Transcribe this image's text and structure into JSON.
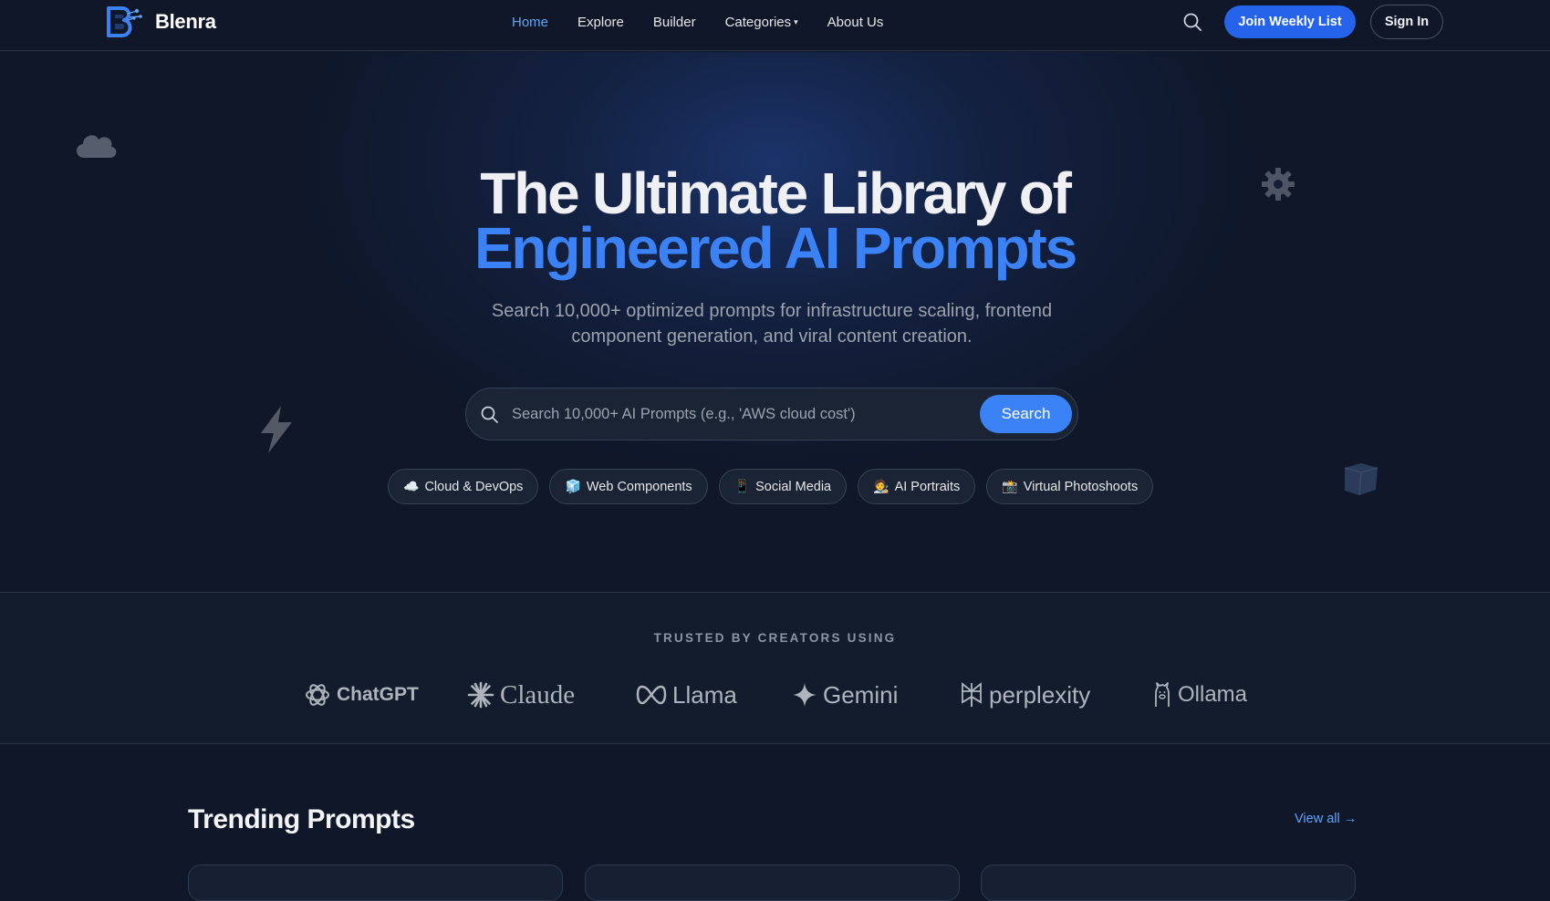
{
  "brand": {
    "name": "Blenra"
  },
  "nav": {
    "links": [
      {
        "label": "Home",
        "active": true
      },
      {
        "label": "Explore"
      },
      {
        "label": "Builder"
      },
      {
        "label": "Categories",
        "caret": "▾"
      },
      {
        "label": "About Us"
      }
    ],
    "search_icon": "search-icon",
    "join_label": "Join Weekly List",
    "signin_label": "Sign In"
  },
  "hero": {
    "title_line1": "The Ultimate Library of",
    "title_line2": "Engineered AI Prompts",
    "subtitle": "Search 10,000+ optimized prompts for infrastructure scaling, frontend component generation, and viral content creation.",
    "search": {
      "placeholder": "Search 10,000+ AI Prompts (e.g., 'AWS cloud cost')",
      "value": "",
      "button_label": "Search"
    },
    "chips": [
      {
        "emoji": "☁️",
        "label": "Cloud & DevOps"
      },
      {
        "emoji": "🧊",
        "label": "Web Components"
      },
      {
        "emoji": "📱",
        "label": "Social Media"
      },
      {
        "emoji": "🧑‍🎨",
        "label": "AI Portraits"
      },
      {
        "emoji": "📸",
        "label": "Virtual Photoshoots"
      }
    ],
    "decorations": [
      "cloud-icon",
      "gear-icon",
      "lightning-icon",
      "cube-icon"
    ]
  },
  "trusted": {
    "title": "TRUSTED BY CREATORS USING",
    "logos": [
      "ChatGPT",
      "Claude",
      "Llama",
      "Gemini",
      "perplexity",
      "Ollama"
    ]
  },
  "trending": {
    "title": "Trending Prompts",
    "view_all": "View all →"
  },
  "colors": {
    "background": "#0f1729",
    "accent": "#3b82f6",
    "join_button": "#2563eb",
    "link_active": "#60a5fa"
  }
}
